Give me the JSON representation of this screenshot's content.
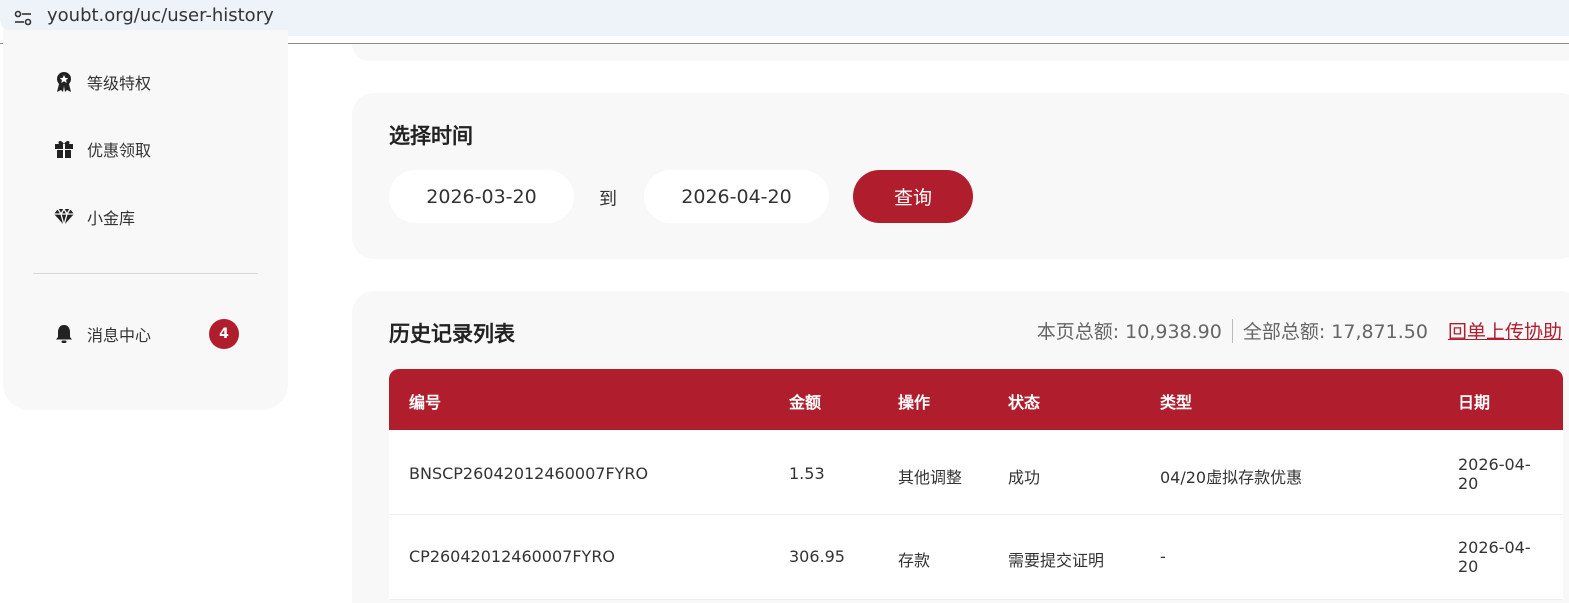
{
  "browser": {
    "url": "youbt.org/uc/user-history"
  },
  "sidebar": {
    "items": [
      {
        "label": "等级特权",
        "icon": "medal-icon"
      },
      {
        "label": "优惠领取",
        "icon": "gift-icon"
      },
      {
        "label": "小金库",
        "icon": "diamond-icon"
      },
      {
        "label": "消息中心",
        "icon": "bell-icon",
        "badge": "4"
      }
    ]
  },
  "time_section": {
    "title": "选择时间",
    "start_date": "2026-03-20",
    "to_label": "到",
    "end_date": "2026-04-20",
    "query_label": "查询"
  },
  "history": {
    "title": "历史记录列表",
    "page_total": "本页总额: 10,938.90",
    "all_total": "全部总额: 17,871.50",
    "upload_link": "回单上传协助",
    "columns": [
      "编号",
      "金额",
      "操作",
      "状态",
      "类型",
      "日期"
    ],
    "rows": [
      {
        "id": "BNSCP26042012460007FYRO",
        "amount": "1.53",
        "action": "其他调整",
        "status": "成功",
        "type": "04/20虚拟存款优惠",
        "date": "2026-04-20"
      },
      {
        "id": "CP26042012460007FYRO",
        "amount": "306.95",
        "action": "存款",
        "status": "需要提交证明",
        "type": "-",
        "date": "2026-04-20"
      }
    ]
  },
  "colors": {
    "accent": "#b01e2d",
    "card_bg": "#f8f8f9"
  }
}
